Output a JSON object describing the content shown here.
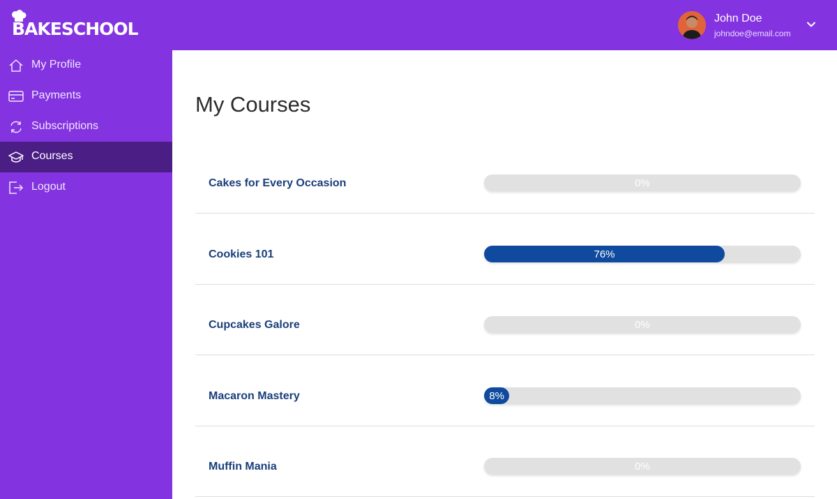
{
  "brand": {
    "name": "BAKESCHOOL",
    "accent": "#8433e0",
    "active_nav": "#4a1e85",
    "progress_color": "#0f4a9e"
  },
  "user": {
    "name": "John Doe",
    "email": "johndoe@email.com"
  },
  "sidebar": {
    "items": [
      {
        "label": "My Profile",
        "icon": "home-icon",
        "active": false
      },
      {
        "label": "Payments",
        "icon": "credit-card-icon",
        "active": false
      },
      {
        "label": "Subscriptions",
        "icon": "refresh-icon",
        "active": false
      },
      {
        "label": "Courses",
        "icon": "graduation-cap-icon",
        "active": true
      },
      {
        "label": "Logout",
        "icon": "logout-icon",
        "active": false
      }
    ]
  },
  "main": {
    "title": "My Courses",
    "courses": [
      {
        "title": "Cakes for Every Occasion",
        "progress": 0,
        "progress_label": "0%"
      },
      {
        "title": "Cookies 101",
        "progress": 76,
        "progress_label": "76%"
      },
      {
        "title": "Cupcakes Galore",
        "progress": 0,
        "progress_label": "0%"
      },
      {
        "title": "Macaron Mastery",
        "progress": 8,
        "progress_label": "8%"
      },
      {
        "title": "Muffin Mania",
        "progress": 0,
        "progress_label": "0%"
      }
    ]
  }
}
